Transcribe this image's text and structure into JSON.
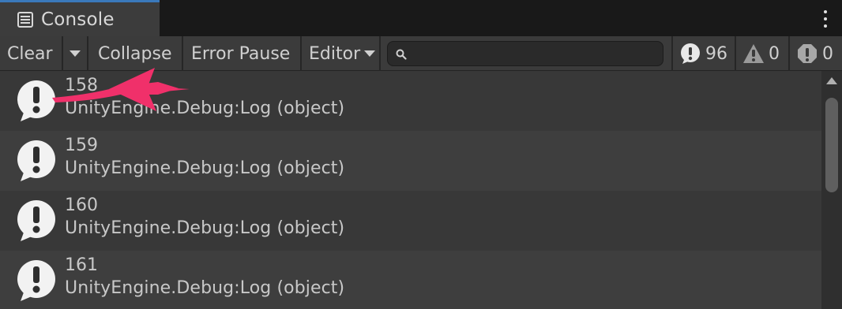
{
  "window": {
    "tab_title": "Console",
    "tab_icon": "console-list-icon",
    "menu_icon": "kebab-menu-icon"
  },
  "toolbar": {
    "clear_label": "Clear",
    "collapse_label": "Collapse",
    "error_pause_label": "Error Pause",
    "editor_label": "Editor",
    "search_placeholder": "",
    "counts": {
      "log": "96",
      "warning": "0",
      "error": "0"
    }
  },
  "logs": [
    {
      "number": "158",
      "message": "UnityEngine.Debug:Log (object)"
    },
    {
      "number": "159",
      "message": "UnityEngine.Debug:Log (object)"
    },
    {
      "number": "160",
      "message": "UnityEngine.Debug:Log (object)"
    },
    {
      "number": "161",
      "message": "UnityEngine.Debug:Log (object)"
    }
  ],
  "colors": {
    "accent": "#3a79bb",
    "annotation_arrow": "#f0306a",
    "background": "#282828",
    "row_even": "#383838",
    "row_odd": "#3e3e3e"
  }
}
